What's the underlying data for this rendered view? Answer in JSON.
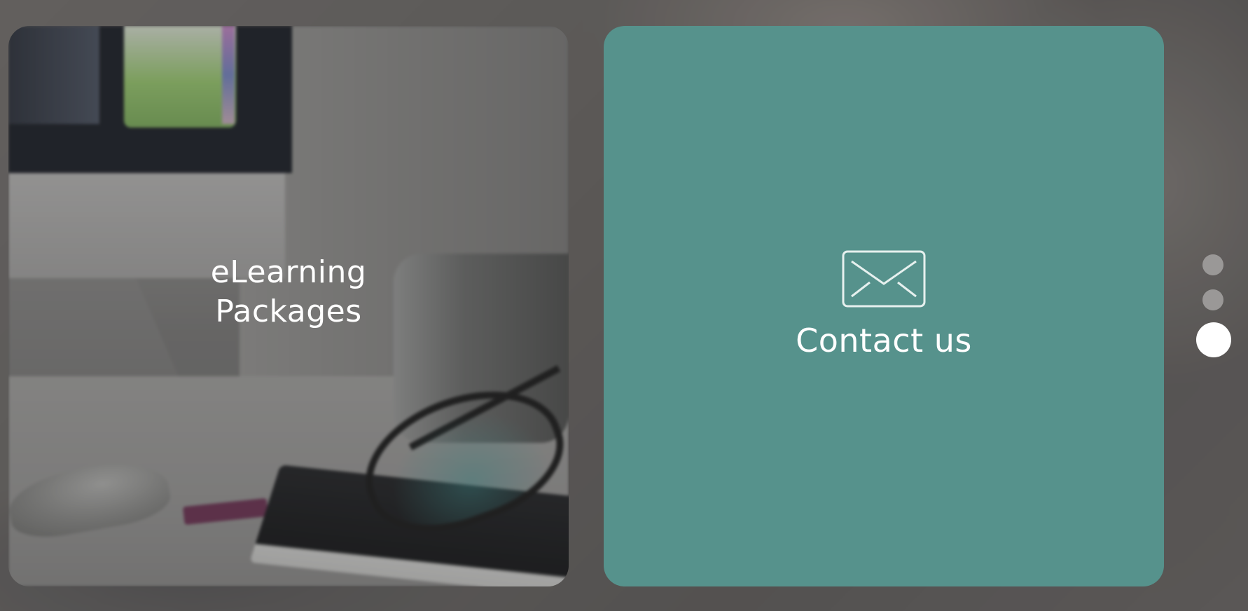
{
  "tiles": [
    {
      "id": "elearning",
      "label": "eLearning\nPackages"
    },
    {
      "id": "contact",
      "label": "Contact us",
      "icon": "envelope-icon",
      "background": "#56928c"
    }
  ],
  "pagination": {
    "total": 3,
    "active_index": 2
  }
}
